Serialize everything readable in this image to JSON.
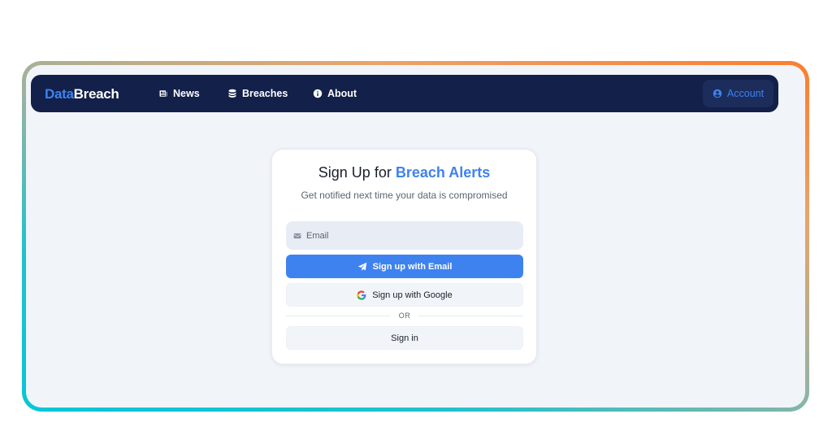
{
  "brand": {
    "part1": "Data",
    "part2": "Breach"
  },
  "nav": {
    "news": {
      "label": "News",
      "icon": "newspaper-icon"
    },
    "breaches": {
      "label": "Breaches",
      "icon": "database-icon"
    },
    "about": {
      "label": "About",
      "icon": "info-circle-icon"
    },
    "account": {
      "label": "Account",
      "icon": "user-circle-icon"
    }
  },
  "signup": {
    "title_prefix": "Sign Up for ",
    "title_accent": "Breach Alerts",
    "subtitle": "Get notified next time your data is compromised",
    "email_placeholder": "Email",
    "email_value": "",
    "email_button": "Sign up with Email",
    "google_button": "Sign up with Google",
    "divider": "OR",
    "signin_button": "Sign in"
  },
  "colors": {
    "accent": "#3e82f0",
    "navbar_bg": "#12204a",
    "page_bg": "#f1f4f9",
    "frame_gradient_start": "#06c6d8",
    "frame_gradient_end": "#fb7d2e"
  }
}
